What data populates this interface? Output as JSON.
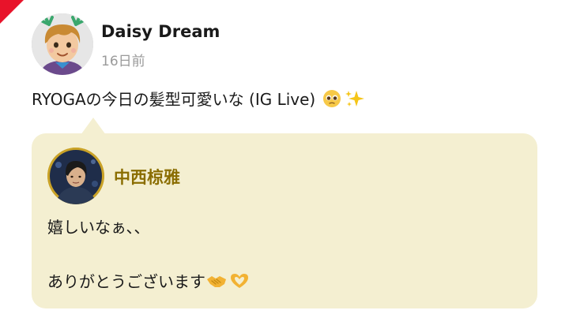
{
  "post": {
    "author_name": "Daisy Dream",
    "time": "16日前",
    "body_text": "RYOGAの今日の髪型可愛いな (IG Live)",
    "body_emojis": [
      "pleading-face-emoji",
      "sparkles-emoji"
    ]
  },
  "reply": {
    "name": "中西椋雅",
    "line1": "嬉しいなぁ､､",
    "line2": "ありがとうございます",
    "line2_emojis": [
      "handshake-emoji",
      "heart-hands-emoji"
    ]
  },
  "colors": {
    "reply_bubble": "#f4efd1",
    "replier_name": "#8a6d00",
    "corner_flag": "#e8132a",
    "time_text": "#9a9a9a"
  }
}
